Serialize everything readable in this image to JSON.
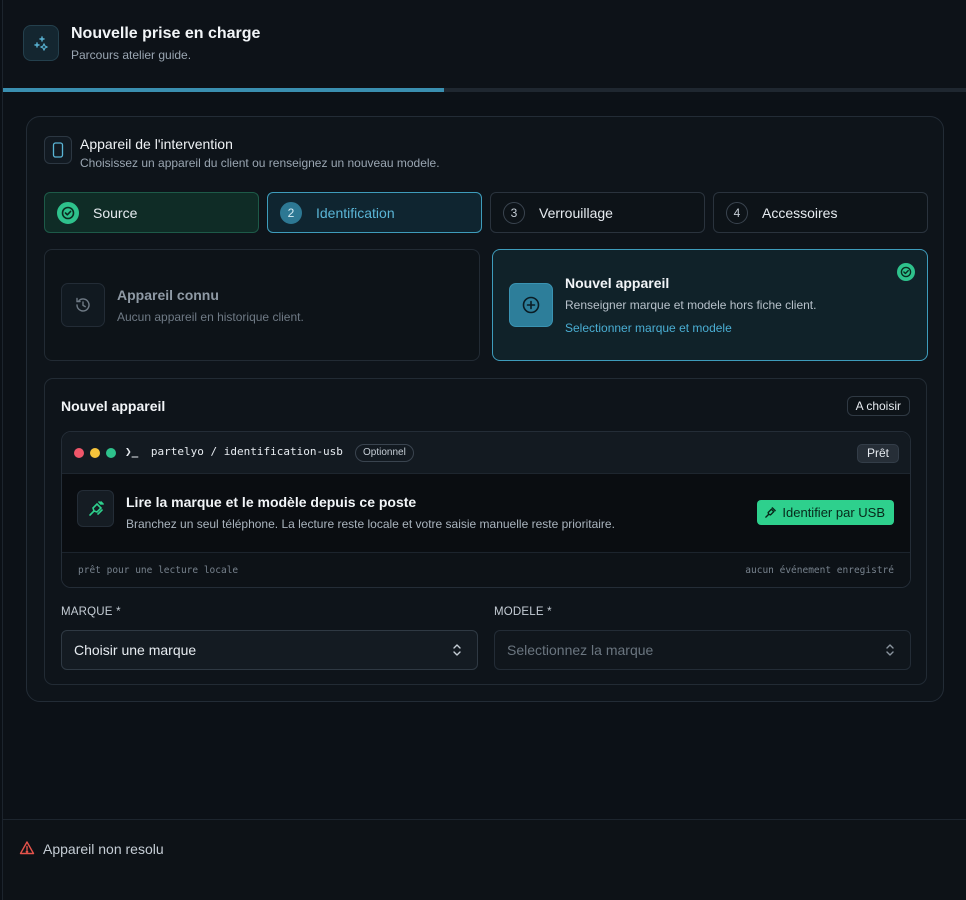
{
  "header": {
    "title": "Nouvelle prise en charge",
    "subtitle": "Parcours atelier guide.",
    "progress_fraction": 0.457,
    "icon": "sparkles-icon"
  },
  "card": {
    "title": "Appareil de l'intervention",
    "subtitle": "Choisissez un appareil du client ou renseignez un nouveau modele.",
    "icon": "smartphone-icon"
  },
  "steps": [
    {
      "num": "",
      "label": "Source",
      "state": "done"
    },
    {
      "num": "2",
      "label": "Identification",
      "state": "active"
    },
    {
      "num": "3",
      "label": "Verrouillage",
      "state": "pending"
    },
    {
      "num": "4",
      "label": "Accessoires",
      "state": "pending"
    }
  ],
  "options": {
    "known": {
      "title": "Appareil connu",
      "desc": "Aucun appareil en historique client.",
      "icon": "history-icon"
    },
    "new": {
      "title": "Nouvel appareil",
      "desc": "Renseigner marque et modele hors fiche client.",
      "link": "Selectionner marque et modele",
      "icon": "plus-circle-icon"
    }
  },
  "panel": {
    "title": "Nouvel appareil",
    "badge": "A choisir"
  },
  "terminal": {
    "prompt_symbol": "❯_",
    "path": "partelyo / identification-usb",
    "optional_label": "Optionnel",
    "status": "Prêt",
    "heading": "Lire la marque et le modèle depuis ce poste",
    "desc": "Branchez un seul téléphone. La lecture reste locale et votre saisie manuelle reste prioritaire.",
    "button": "Identifier par USB",
    "foot_left": "prêt pour une lecture locale",
    "foot_right": "aucun événement enregistré",
    "colors": {
      "red": "#f0566a",
      "yellow": "#f5c33b",
      "green": "#2ec28c"
    }
  },
  "fields": {
    "brand": {
      "label": "MARQUE *",
      "value": "Choisir une marque"
    },
    "model": {
      "label": "MODELE *",
      "value": "Selectionnez la marque"
    }
  },
  "footer": {
    "text": "Appareil non resolu",
    "icon": "warning-icon",
    "color": "#e5534b"
  }
}
